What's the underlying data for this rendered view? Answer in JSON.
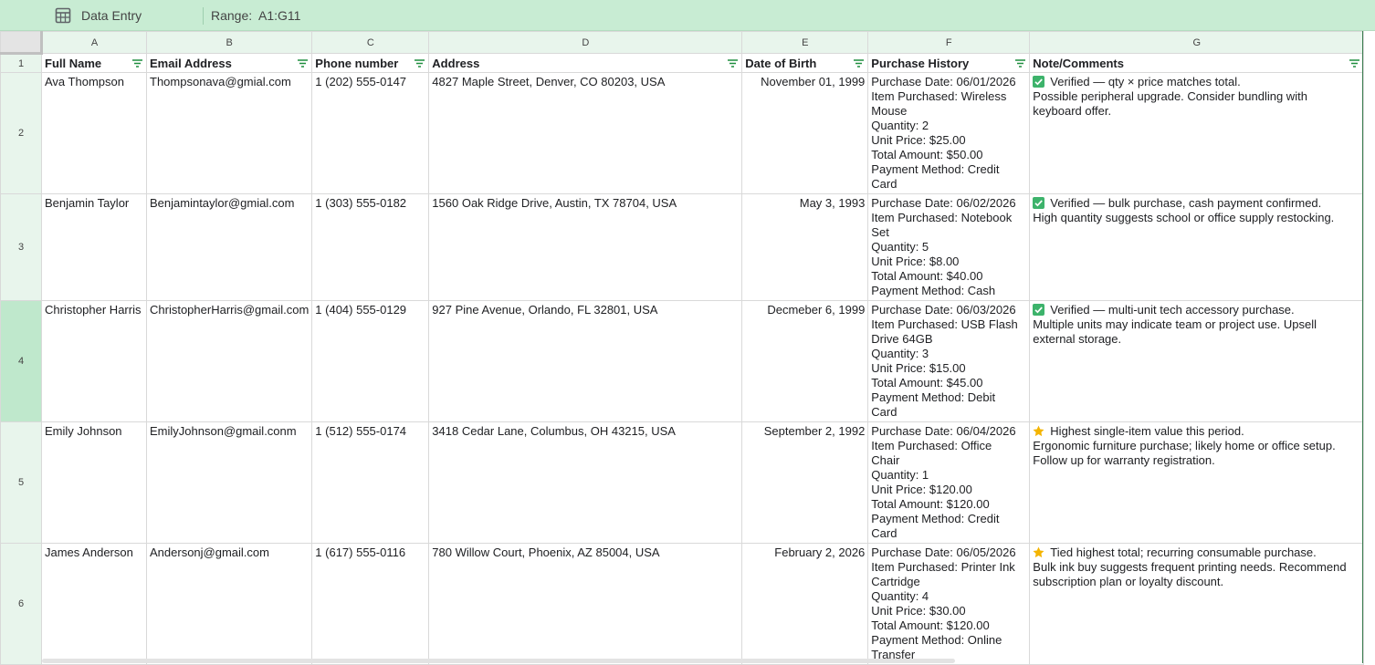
{
  "toolbar": {
    "table_name": "Data Entry",
    "range_label": "Range:",
    "range_value": "A1:G11"
  },
  "columns": [
    "A",
    "B",
    "C",
    "D",
    "E",
    "F",
    "G"
  ],
  "headers": [
    "Full Name",
    "Email Address",
    "Phone number",
    "Address",
    "Date of Birth",
    "Purchase History",
    "Note/Comments"
  ],
  "rows": [
    {
      "num": "2",
      "name": "Ava Thompson",
      "email": "Thompsonava@gmial.com",
      "phone": "1 (202) 555-0147",
      "address": "4827 Maple Street, Denver, CO 80203, USA",
      "dob": "November 01, 1999",
      "purchase": [
        " Purchase Date: 06/01/2026",
        "Item Purchased: Wireless",
        "Mouse",
        "Quantity: 2",
        "Unit Price: $25.00",
        "Total Amount: $50.00",
        "Payment Method: Credit",
        "Card"
      ],
      "note_icon": "check-icon",
      "note_title": "Verified — qty × price matches total.",
      "note_body": [
        "Possible peripheral upgrade. Consider bundling with",
        "keyboard offer."
      ]
    },
    {
      "num": "3",
      "name": "Benjamin Taylor",
      "email": "Benjamintaylor@gmial.com",
      "phone": "1 (303) 555-0182",
      "address": "1560 Oak Ridge Drive, Austin, TX 78704, USA",
      "dob": "May 3, 1993",
      "purchase": [
        "Purchase Date: 06/02/2026",
        "Item Purchased: Notebook",
        "Set",
        "Quantity: 5",
        "Unit Price: $8.00",
        "Total Amount: $40.00",
        "Payment Method: Cash"
      ],
      "note_icon": "check-icon",
      "note_title": "Verified — bulk purchase, cash payment confirmed.",
      "note_body": [
        "High quantity suggests school or office supply restocking."
      ]
    },
    {
      "num": "4",
      "name": "Christopher Harris",
      "email": "ChristopherHarris@gmail.com",
      "phone": "1 (404) 555-0129",
      "address": "927 Pine Avenue, Orlando, FL 32801, USA",
      "dob": "Decmeber 6, 1999",
      "purchase": [
        "Purchase Date: 06/03/2026",
        "Item Purchased: USB Flash",
        "Drive 64GB",
        "Quantity: 3",
        "Unit Price: $15.00",
        "Total Amount: $45.00",
        "Payment Method: Debit",
        "Card"
      ],
      "note_icon": "check-icon",
      "note_title": "Verified — multi-unit tech accessory purchase.",
      "note_body": [
        "Multiple units may indicate team or project use. Upsell",
        "external storage."
      ]
    },
    {
      "num": "5",
      "name": "Emily Johnson",
      "email": "EmilyJohnson@gmail.conm",
      "phone": "1 (512) 555-0174",
      "address": "3418 Cedar Lane, Columbus, OH 43215, USA",
      "dob": "September 2, 1992",
      "purchase": [
        "Purchase Date: 06/04/2026",
        "Item Purchased: Office",
        "Chair",
        "Quantity: 1",
        "Unit Price: $120.00",
        "Total Amount: $120.00",
        "Payment Method: Credit",
        "Card"
      ],
      "note_icon": "star-icon",
      "note_title": "Highest single-item value this period.",
      "note_body": [
        "Ergonomic furniture purchase; likely home or office setup.",
        "Follow up for warranty registration."
      ]
    },
    {
      "num": "6",
      "name": "James Anderson",
      "email": "Andersonj@gmail.com",
      "phone": "1 (617) 555-0116",
      "address": "780 Willow Court, Phoenix, AZ 85004, USA",
      "dob": "February 2, 2026",
      "purchase": [
        "Purchase Date: 06/05/2026",
        "Item Purchased: Printer Ink",
        "Cartridge",
        "Quantity: 4",
        "Unit Price: $30.00",
        "Total Amount: $120.00",
        "Payment Method: Online",
        "Transfer"
      ],
      "note_icon": "star-icon",
      "note_title": "Tied highest total; recurring consumable purchase.",
      "note_body": [
        "Bulk ink buy suggests frequent printing needs. Recommend",
        "subscription plan or loyalty discount."
      ]
    }
  ],
  "selected_row": "4",
  "colors": {
    "toolbar_bg": "#c8ecd3",
    "header_bg": "#e8f5ec",
    "selected_row_bg": "#bfe8cc",
    "check": "#3db36b",
    "star": "#f4b400"
  }
}
